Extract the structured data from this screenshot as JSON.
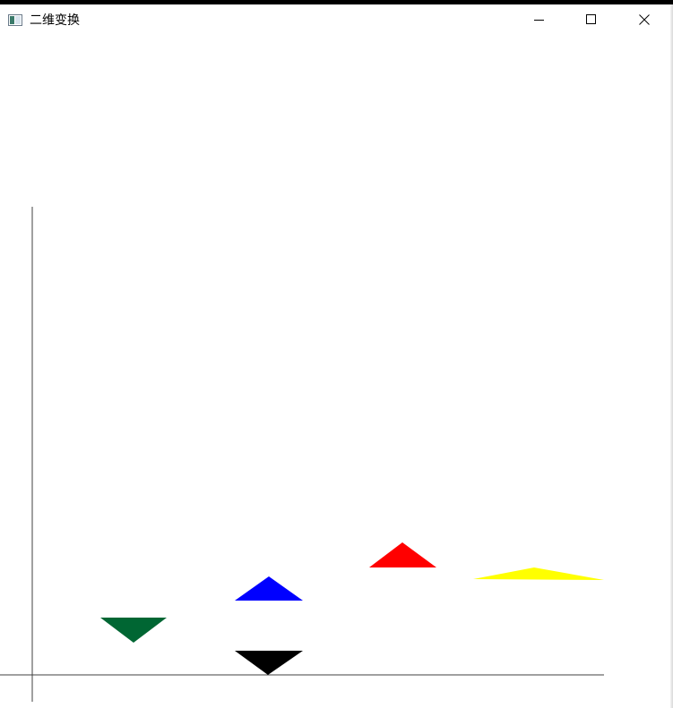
{
  "window": {
    "title": "二维变换",
    "controls": {
      "minimize": "minimize",
      "maximize": "maximize",
      "close": "close"
    }
  },
  "scene": {
    "background": "#ffffff",
    "axis_color": "#404040",
    "shapes": [
      {
        "name": "red-triangle",
        "color": "#ff0000",
        "orientation": "up"
      },
      {
        "name": "yellow-triangle",
        "color": "#ffff00",
        "orientation": "up"
      },
      {
        "name": "blue-triangle",
        "color": "#0000ff",
        "orientation": "up"
      },
      {
        "name": "green-triangle",
        "color": "#006633",
        "orientation": "down"
      },
      {
        "name": "black-triangle",
        "color": "#000000",
        "orientation": "down"
      }
    ]
  }
}
